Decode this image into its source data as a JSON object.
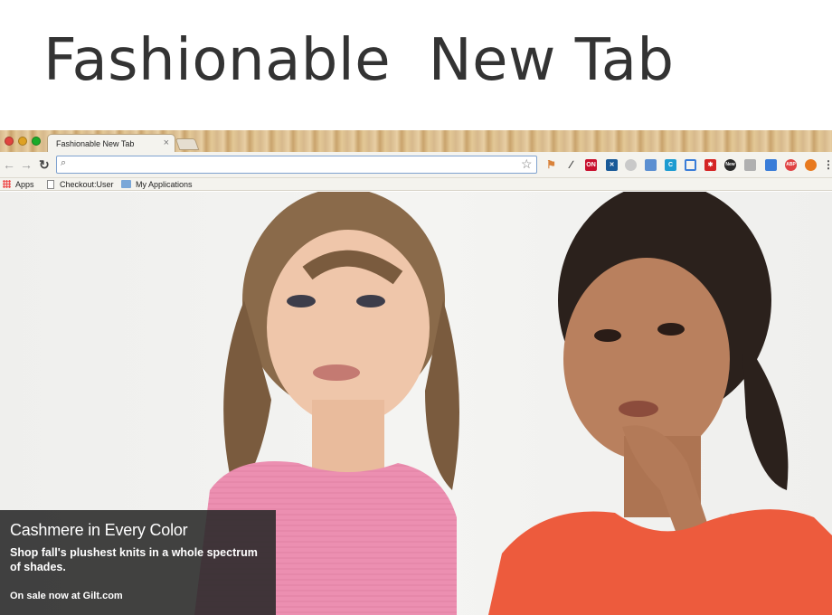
{
  "slide": {
    "title": "Fashionable  New Tab"
  },
  "browser": {
    "tab": {
      "title": "Fashionable New Tab",
      "close_glyph": "×"
    },
    "toolbar": {
      "omnibox_value": "",
      "extensions": [
        {
          "icon": "pin-icon",
          "color": "#d9833b"
        },
        {
          "icon": "eyedropper-icon",
          "color": "#3a3a3a"
        },
        {
          "icon": "on-badge-icon",
          "color": "#c8102e",
          "label": "ON"
        },
        {
          "icon": "x-badge-icon",
          "color": "#1a5a98"
        },
        {
          "icon": "circle-extension-icon",
          "color": "#999999"
        },
        {
          "icon": "screenshot-icon",
          "color": "#5b8fd1"
        },
        {
          "icon": "c-extension-icon",
          "color": "#1d9bd1"
        },
        {
          "icon": "frame-icon",
          "color": "#3a7dd8"
        },
        {
          "icon": "asterisk-icon",
          "color": "#d42424"
        },
        {
          "icon": "new-badge-icon",
          "color": "#2a2a2a",
          "label": "New"
        },
        {
          "icon": "gray-extension-icon",
          "color": "#b0b0b0"
        },
        {
          "icon": "window-icon",
          "color": "#3a7dd8"
        },
        {
          "icon": "abp-icon",
          "color": "#e04343",
          "label": "ABP"
        },
        {
          "icon": "fire-icon",
          "color": "#e8791e"
        },
        {
          "icon": "menu-icon",
          "color": "#444444"
        }
      ]
    },
    "bookmarks": [
      {
        "label": "Apps",
        "icon": "apps-grid-icon"
      },
      {
        "label": "Checkout:User",
        "icon": "page-icon"
      },
      {
        "label": "My Applications",
        "icon": "folder-icon"
      }
    ]
  },
  "caption": {
    "title": "Cashmere in Every Color",
    "description": "Shop fall's plushest knits in a whole spectrum of shades.",
    "link": "On sale now at Gilt.com"
  },
  "colors": {
    "caption_bg": "#282828",
    "pink_sweater": "#ec8fb1",
    "coral_sweater": "#ed5b3d"
  }
}
